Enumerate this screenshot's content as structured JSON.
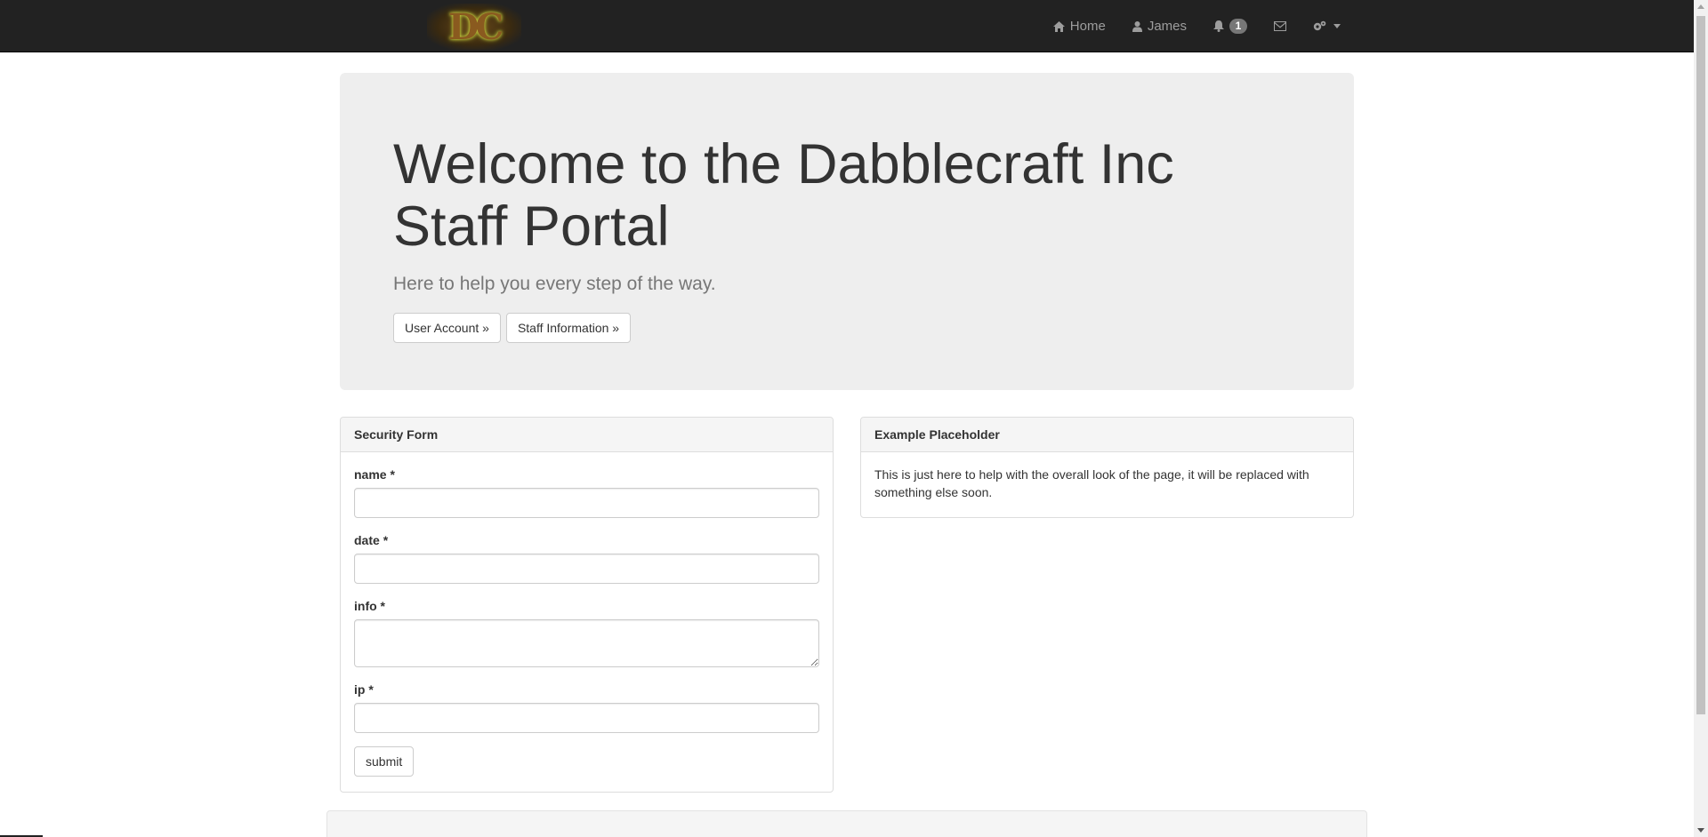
{
  "navbar": {
    "brand_text": "DC",
    "items": [
      {
        "label": "Home",
        "icon": "home-icon"
      },
      {
        "label": "James",
        "icon": "user-icon"
      },
      {
        "label": "",
        "icon": "bell-icon",
        "badge": "1"
      },
      {
        "label": "",
        "icon": "envelope-icon"
      },
      {
        "label": "",
        "icon": "cogs-icon"
      }
    ]
  },
  "jumbotron": {
    "title": "Welcome to the Dabblecraft Inc Staff Portal",
    "lead": "Here to help you every step of the way.",
    "buttons": [
      "User Account »",
      "Staff Information »"
    ]
  },
  "security_form": {
    "heading": "Security Form",
    "fields": [
      {
        "label": "name",
        "required_mark": "*",
        "value": ""
      },
      {
        "label": "date",
        "required_mark": "*",
        "value": ""
      },
      {
        "label": "info",
        "required_mark": "*",
        "value": ""
      },
      {
        "label": "ip",
        "required_mark": "*",
        "value": ""
      }
    ],
    "submit_label": "submit"
  },
  "placeholder_panel": {
    "heading": "Example Placeholder",
    "body": "This is just here to help with the overall look of the page, it will be replaced with something else soon."
  },
  "colors": {
    "navbar_bg": "#222222",
    "jumbotron_bg": "#eeeeee",
    "panel_heading_bg": "#f5f5f5"
  }
}
